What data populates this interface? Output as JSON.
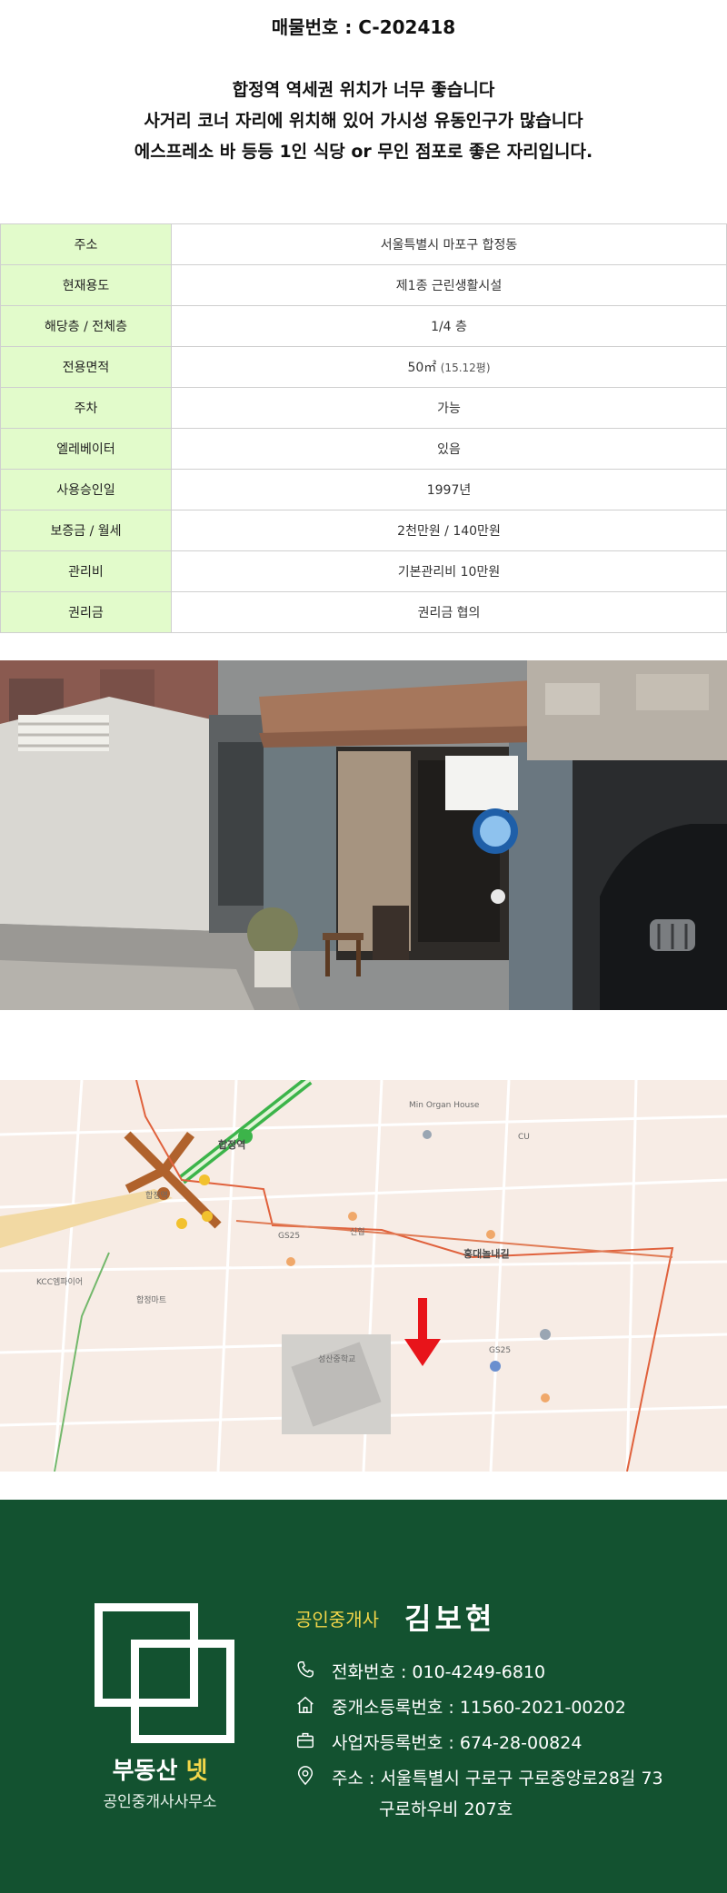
{
  "header": {
    "listing_number": "매물번호 : C-202418"
  },
  "description": [
    "합정역 역세권 위치가 너무 좋습니다",
    "사거리 코너 자리에 위치해 있어 가시성 유동인구가 많습니다",
    "에스프레소 바 등등 1인 식당 or 무인 점포로 좋은 자리입니다."
  ],
  "info_table": [
    {
      "label": "주소",
      "value": "서울특별시 마포구 합정동"
    },
    {
      "label": "현재용도",
      "value": "제1종 근린생활시설"
    },
    {
      "label": "해당층 / 전체층",
      "value": "1/4 층"
    },
    {
      "label": "전용면적",
      "value": "50㎡",
      "sub": "(15.12평)"
    },
    {
      "label": "주차",
      "value": "가능"
    },
    {
      "label": "엘레베이터",
      "value": "있음"
    },
    {
      "label": "사용승인일",
      "value": "1997년"
    },
    {
      "label": "보증금 / 월세",
      "value": "2천만원 / 140만원"
    },
    {
      "label": "관리비",
      "value": "기본관리비 10만원"
    },
    {
      "label": "권리금",
      "value": "권리금 협의"
    }
  ],
  "map": {
    "labels": {
      "station": "합정역",
      "road": "홍대놀내길",
      "school": "성산중학교",
      "mart": "합정마트",
      "gs25_a": "GS25",
      "gs25_b": "GS25",
      "cu": "CU",
      "minorgan": "Min Organ House",
      "sinhan": "신협",
      "ktwon": "KCC엠파이어"
    }
  },
  "footer": {
    "brand_main": "부동산",
    "brand_accent": "넷",
    "brand_sub": "공인중개사사무소",
    "agent_role": "공인중개사",
    "agent_name": "김보현",
    "phone": "전화번호 : 010-4249-6810",
    "broker_reg": "중개소등록번호 : 11560-2021-00202",
    "biz_reg": "사업자등록번호 : 674-28-00824",
    "address_line1": "주소 : 서울특별시 구로구 구로중앙로28길 73",
    "address_line2": "구로하우비 207호"
  },
  "colors": {
    "table_label_bg": "#e2fbcb",
    "footer_bg": "#135230",
    "accent_yellow": "#f2d64a",
    "map_arrow": "#e8141a"
  },
  "icons": [
    "phone-icon",
    "home-icon",
    "briefcase-icon",
    "location-pin-icon"
  ]
}
